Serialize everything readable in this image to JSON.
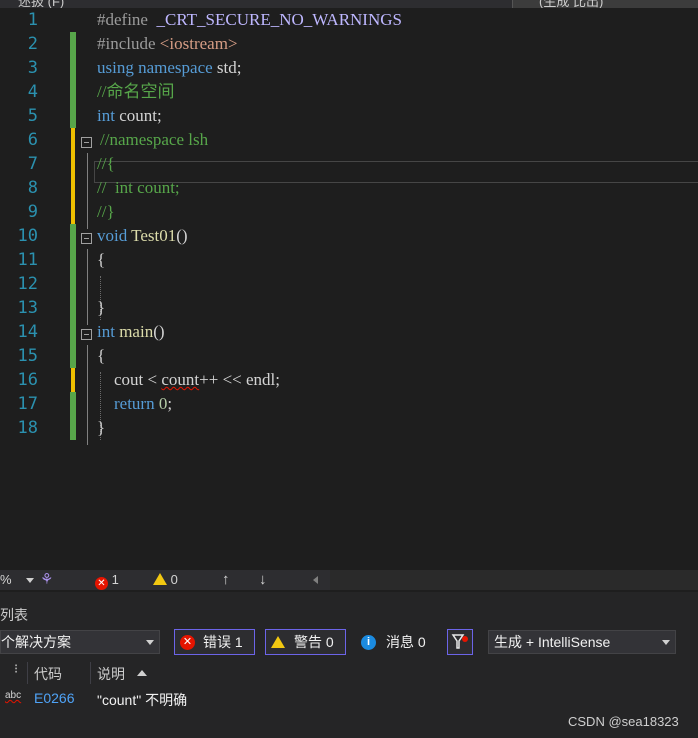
{
  "top_tabs": {
    "left": "述扱 (F)",
    "right": "(生成 比出)"
  },
  "code_lines": [
    {
      "n": "1",
      "bar": ""
    },
    {
      "n": "2",
      "bar": "green"
    },
    {
      "n": "3",
      "bar": "green"
    },
    {
      "n": "4",
      "bar": "green"
    },
    {
      "n": "5",
      "bar": "green"
    },
    {
      "n": "6",
      "bar": "yellow"
    },
    {
      "n": "7",
      "bar": "yellow"
    },
    {
      "n": "8",
      "bar": "yellow"
    },
    {
      "n": "9",
      "bar": "yellow"
    },
    {
      "n": "10",
      "bar": "green"
    },
    {
      "n": "11",
      "bar": "green"
    },
    {
      "n": "12",
      "bar": "green"
    },
    {
      "n": "13",
      "bar": "green"
    },
    {
      "n": "14",
      "bar": "green"
    },
    {
      "n": "15",
      "bar": "green"
    },
    {
      "n": "16",
      "bar": "yellow"
    },
    {
      "n": "17",
      "bar": "green"
    },
    {
      "n": "18",
      "bar": "green"
    }
  ],
  "code": {
    "l1_a": "#define",
    "l1_b": "  _CRT_SECURE_NO_WARNINGS",
    "l2_a": "#include ",
    "l2_b": "<iostream>",
    "l3_a": "using",
    "l3_b": " namespace",
    "l3_c": " std;",
    "l4": "//命名空间",
    "l5_a": "int",
    "l5_b": " count;",
    "l6": "//namespace lsh",
    "l7": "//{",
    "l8": "//  int count;",
    "l9": "//}",
    "l10_a": "void",
    "l10_b": " Test01",
    "l10_c": "()",
    "l11": "{",
    "l13": "}",
    "l14_a": "int",
    "l14_b": " main",
    "l14_c": "()",
    "l15": "{",
    "l16_a": "    cout < ",
    "l16_b": "count",
    "l16_c": "++ << endl;",
    "l17_a": "    return",
    "l17_b": " 0",
    "l17_c": ";",
    "l18": "}"
  },
  "status_bar": {
    "zoom": "%",
    "errors": "1",
    "warnings": "0"
  },
  "error_list": {
    "title": "列表",
    "scope": "个解决方案",
    "errors_label": "错误 1",
    "warnings_label": "警告 0",
    "messages_label": "消息 0",
    "build_filter": "生成 + IntelliSense",
    "col_code": "代码",
    "col_desc": "说明",
    "rows": [
      {
        "icon": "abc",
        "code": "E0266",
        "desc": "\"count\" 不明确"
      }
    ]
  },
  "watermark": "CSDN @sea18323",
  "colors": {
    "accent": "#6c64e8",
    "error": "#e51400",
    "warning": "#f2c811",
    "change_saved": "#57a64a",
    "change_unsaved": "#efc000"
  }
}
